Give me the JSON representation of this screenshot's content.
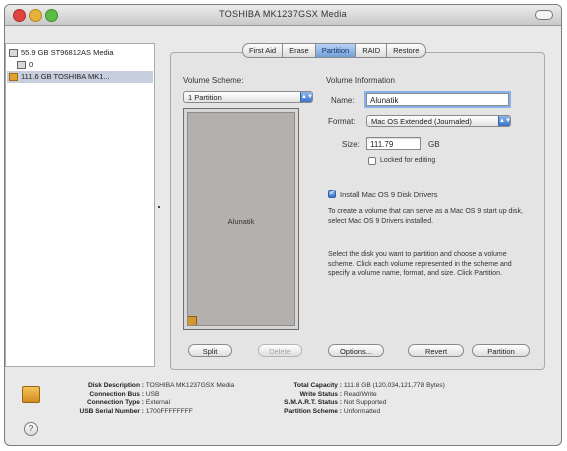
{
  "window": {
    "title": "TOSHIBA MK1237GSX Media"
  },
  "sidebar": {
    "items": [
      {
        "label": "55.9 GB ST96812AS Media",
        "icon": "disk-icon",
        "selected": false
      },
      {
        "label": "0",
        "icon": "volume-icon",
        "selected": false
      },
      {
        "label": "111.6 GB TOSHIBA MK1...",
        "icon": "disk-icon",
        "selected": true
      }
    ]
  },
  "tabs": [
    {
      "label": "First Aid",
      "active": false
    },
    {
      "label": "Erase",
      "active": false
    },
    {
      "label": "Partition",
      "active": true
    },
    {
      "label": "RAID",
      "active": false
    },
    {
      "label": "Restore",
      "active": false
    }
  ],
  "partition": {
    "scheme_label": "Volume Scheme:",
    "scheme_value": "1 Partition",
    "volume_name": "Alunatik",
    "info_label": "Volume Information",
    "name_label": "Name:",
    "name_value": "Alunatik",
    "format_label": "Format:",
    "format_value": "Mac OS Extended (Journaled)",
    "size_label": "Size:",
    "size_value": "111.79",
    "size_unit": "GB",
    "locked_label": "Locked for editing",
    "locked_checked": false,
    "os9_label": "Install Mac OS 9 Disk Drivers",
    "os9_checked": true,
    "os9_help": "To create a volume that can serve as a Mac OS 9 start up disk, select Mac OS 9 Drivers installed.",
    "help_text": "Select the disk you want to partition and choose a volume scheme. Click each volume represented in the scheme and specify a volume name, format, and size. Click Partition."
  },
  "buttons": {
    "split": "Split",
    "delete": "Delete",
    "options": "Options...",
    "revert": "Revert",
    "partition": "Partition"
  },
  "info": {
    "left": [
      {
        "k": "Disk Description :",
        "v": "TOSHIBA MK1237GSX Media"
      },
      {
        "k": "Connection Bus :",
        "v": "USB"
      },
      {
        "k": "Connection Type :",
        "v": "External"
      },
      {
        "k": "USB Serial Number :",
        "v": "1700FFFFFFFF"
      }
    ],
    "right": [
      {
        "k": "Total Capacity :",
        "v": "111.8 GB (120,034,121,778 Bytes)"
      },
      {
        "k": "Write Status :",
        "v": "Read/Write"
      },
      {
        "k": "S.M.A.R.T. Status :",
        "v": "Not Supported"
      },
      {
        "k": "Partition Scheme :",
        "v": "Unformatted"
      }
    ]
  },
  "help_button": "?"
}
